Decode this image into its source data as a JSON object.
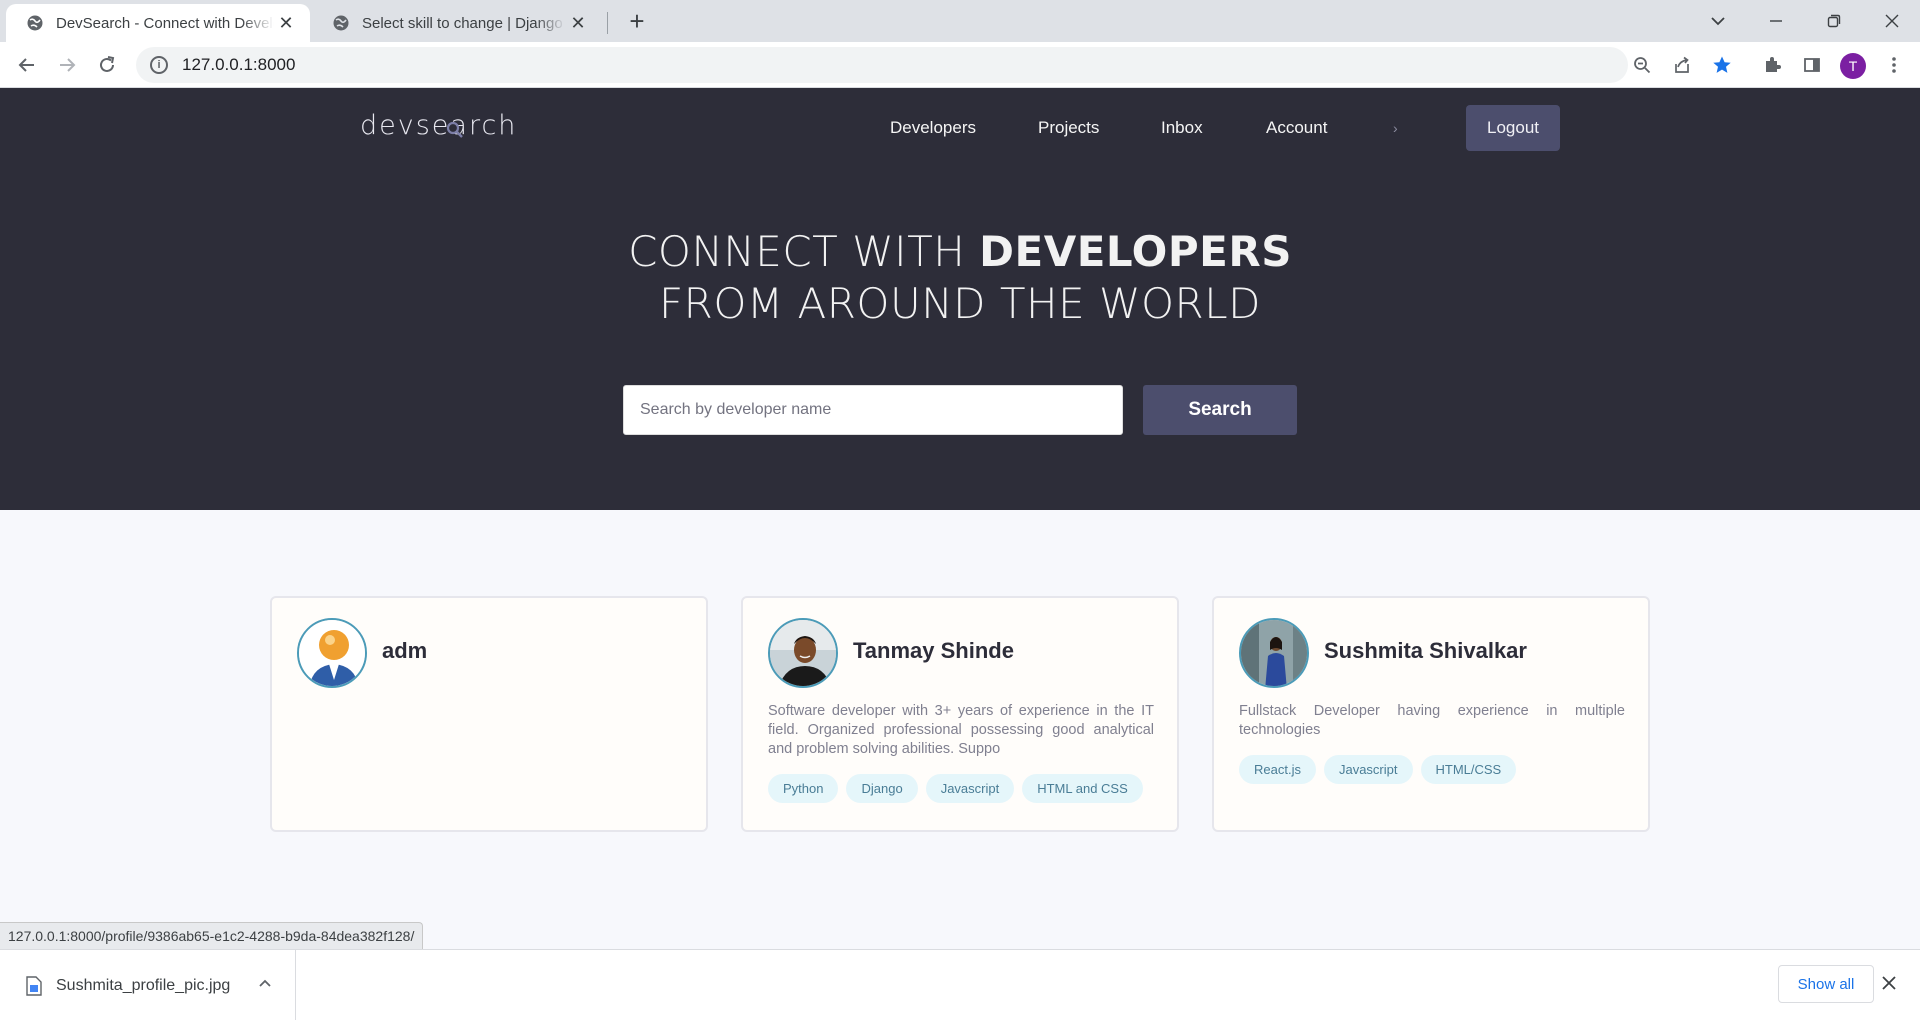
{
  "browser": {
    "tabs": [
      {
        "title": "DevSearch - Connect with Developers"
      },
      {
        "title": "Select skill to change | Django site admin"
      }
    ],
    "url": "127.0.0.1:8000",
    "profile_initial": "T"
  },
  "nav": {
    "logo": "devsearch",
    "items": [
      "Developers",
      "Projects",
      "Inbox",
      "Account",
      "›"
    ],
    "logout": "Logout"
  },
  "hero": {
    "line1_light": "CONNECT WITH ",
    "line1_bold": "DEVELOPERS",
    "line2": "FROM AROUND THE WORLD",
    "search_placeholder": "Search by developer name",
    "search_button": "Search"
  },
  "developers": [
    {
      "name": "adm",
      "bio": "",
      "tags": []
    },
    {
      "name": "Tanmay Shinde",
      "bio": "Software developer with 3+ years of experience in the IT field. Organized professional possessing good analytical and problem solving abilities. Suppo",
      "tags": [
        "Python",
        "Django",
        "Javascript",
        "HTML and CSS"
      ]
    },
    {
      "name": "Sushmita Shivalkar",
      "bio": "Fullstack Developer having experience in multiple technologies",
      "tags": [
        "React.js",
        "Javascript",
        "HTML/CSS"
      ]
    }
  ],
  "status": {
    "hover_url": "127.0.0.1:8000/profile/9386ab65-e1c2-4288-b9da-84dea382f128/"
  },
  "downloads": {
    "file": "Sushmita_profile_pic.jpg",
    "show_all": "Show all"
  },
  "colors": {
    "hero_bg": "#2d2d39",
    "button_bg": "#4c4e6d",
    "tag_bg": "#e5f6fa",
    "accent_star": "#1a73e8"
  }
}
